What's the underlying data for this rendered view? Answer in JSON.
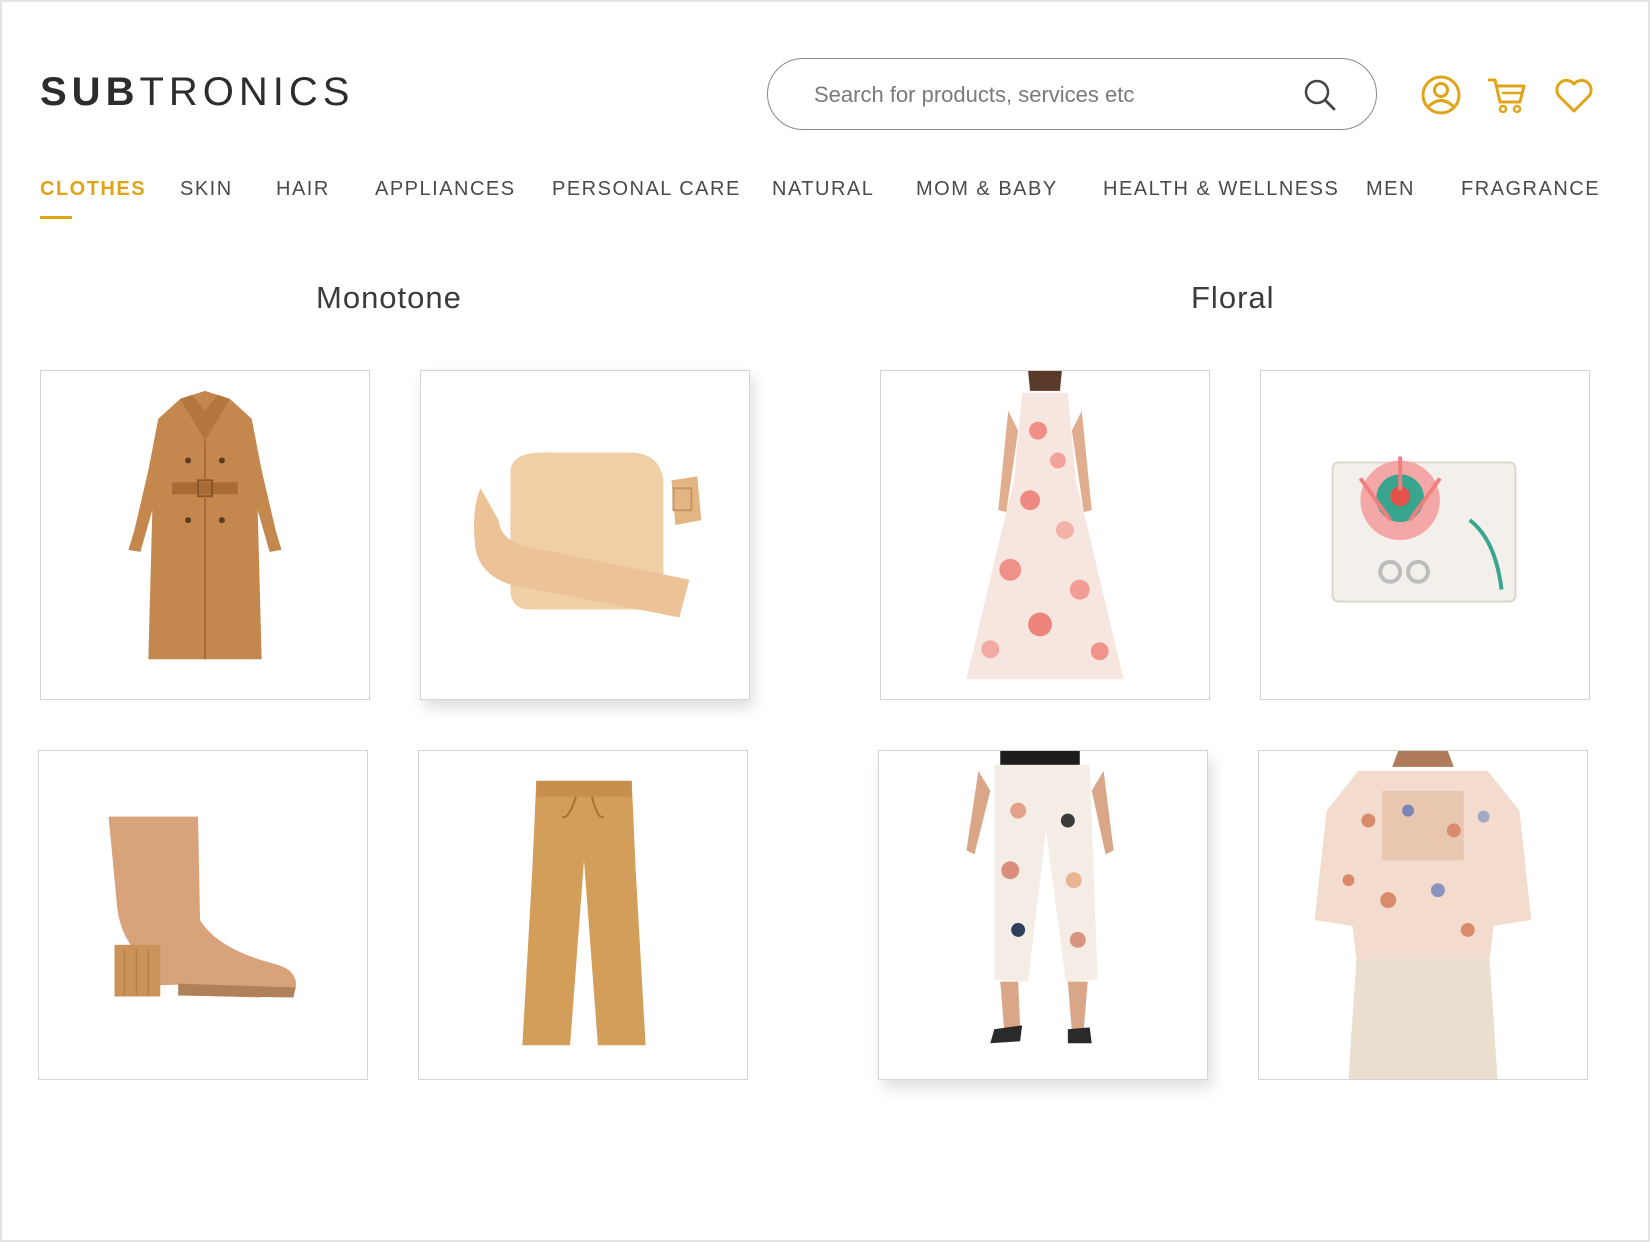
{
  "brand": {
    "part1": "SUB",
    "part2": "TRONICS"
  },
  "search": {
    "placeholder": "Search for products, services etc",
    "value": ""
  },
  "header_icons": [
    "user-icon",
    "cart-icon",
    "heart-icon"
  ],
  "colors": {
    "accent": "#e0a418",
    "text": "#3a3a3a",
    "border": "#d4d4d4"
  },
  "nav": {
    "tabs": [
      {
        "label": "CLOTHES",
        "active": true
      },
      {
        "label": "SKIN",
        "active": false
      },
      {
        "label": "HAIR",
        "active": false
      },
      {
        "label": "APPLIANCES",
        "active": false
      },
      {
        "label": "PERSONAL CARE",
        "active": false
      },
      {
        "label": "NATURAL",
        "active": false
      },
      {
        "label": "MOM & BABY",
        "active": false
      },
      {
        "label": "HEALTH & WELLNESS",
        "active": false
      },
      {
        "label": "MEN",
        "active": false
      },
      {
        "label": "FRAGRANCE",
        "active": false
      }
    ]
  },
  "collections": [
    {
      "title": "Monotone",
      "products": [
        "trench-coat",
        "shoulder-bag",
        "ankle-boot",
        "wide-leg-trousers"
      ]
    },
    {
      "title": "Floral",
      "products": [
        "floral-maxi-dress",
        "floral-wallet",
        "floral-cropped-pants",
        "floral-blouse"
      ]
    }
  ]
}
